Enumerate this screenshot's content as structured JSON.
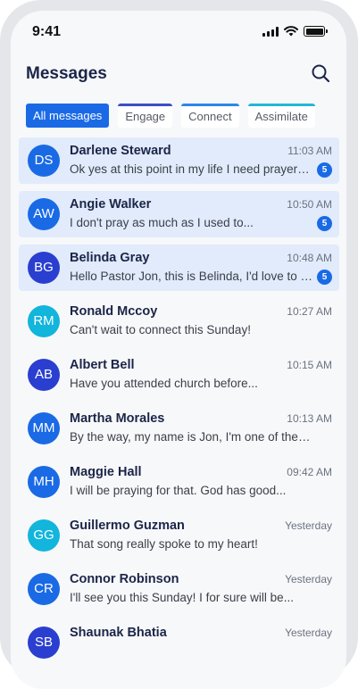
{
  "status_bar": {
    "time": "9:41"
  },
  "header": {
    "title": "Messages"
  },
  "filters": [
    "All messages",
    "Engage",
    "Connect",
    "Assimilate"
  ],
  "colors": {
    "accent": "#1a6ae6",
    "unread_bg": "#e1ebfb",
    "title": "#1b2548"
  },
  "messages": [
    {
      "initials": "DS",
      "name": "Darlene Steward",
      "time": "11:03 AM",
      "preview": "Ok yes at this point in my life I need prayer for my family",
      "unread": 5,
      "avatar_color": "#1a6ae6"
    },
    {
      "initials": "AW",
      "name": "Angie Walker",
      "time": "10:50 AM",
      "preview": "I don't pray as much as I used to...",
      "unread": 5,
      "avatar_color": "#1a6ae6"
    },
    {
      "initials": "BG",
      "name": "Belinda Gray",
      "time": "10:48 AM",
      "preview": "Hello Pastor Jon, this is Belinda, I'd love to chat",
      "unread": 5,
      "avatar_color": "#2a3fd0"
    },
    {
      "initials": "RM",
      "name": "Ronald Mccoy",
      "time": "10:27 AM",
      "preview": "Can't wait to connect this Sunday!",
      "unread": null,
      "avatar_color": "#12b5dc"
    },
    {
      "initials": "AB",
      "name": "Albert Bell",
      "time": "10:15 AM",
      "preview": "Have you attended church before...",
      "unread": null,
      "avatar_color": "#2a3fd0"
    },
    {
      "initials": "MM",
      "name": "Martha Morales",
      "time": "10:13 AM",
      "preview": "By the way, my name is Jon, I'm one of the pastors",
      "unread": null,
      "avatar_color": "#1a6ae6"
    },
    {
      "initials": "MH",
      "name": "Maggie Hall",
      "time": "09:42 AM",
      "preview": "I will be praying for that. God has good...",
      "unread": null,
      "avatar_color": "#1a6ae6"
    },
    {
      "initials": "GG",
      "name": "Guillermo Guzman",
      "time": "Yesterday",
      "preview": "That song really spoke to my heart!",
      "unread": null,
      "avatar_color": "#12b5dc"
    },
    {
      "initials": "CR",
      "name": "Connor Robinson",
      "time": "Yesterday",
      "preview": "I'll see you this Sunday! I for sure will be...",
      "unread": null,
      "avatar_color": "#1a6ae6"
    },
    {
      "initials": "SB",
      "name": "Shaunak Bhatia",
      "time": "Yesterday",
      "preview": "",
      "unread": null,
      "avatar_color": "#2a3fd0"
    }
  ]
}
